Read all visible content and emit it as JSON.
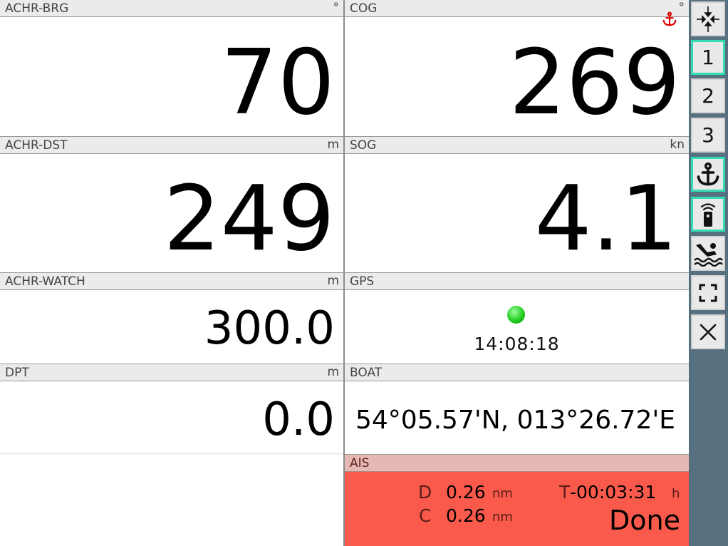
{
  "panels": {
    "achr_brg": {
      "name": "ACHR-BRG",
      "unit": "°",
      "value": "70"
    },
    "cog": {
      "name": "COG",
      "unit": "°",
      "value": "269"
    },
    "achr_dst": {
      "name": "ACHR-DST",
      "unit": "m",
      "value": "249"
    },
    "sog": {
      "name": "SOG",
      "unit": "kn",
      "value": "4.1"
    },
    "achr_watch": {
      "name": "ACHR-WATCH",
      "unit": "m",
      "value": "300.0"
    },
    "gps": {
      "name": "GPS",
      "time": "14:08:18",
      "status_color": "#22cc22"
    },
    "dpt": {
      "name": "DPT",
      "unit": "m",
      "value": "0.0"
    },
    "boat": {
      "name": "BOAT",
      "position": "54°05.57'N, 013°26.72'E"
    },
    "ais": {
      "name": "AIS",
      "d_label": "D",
      "d_value": "0.26",
      "d_unit": "nm",
      "c_label": "C",
      "c_value": "0.26",
      "c_unit": "nm",
      "t_label": "T",
      "t_value": "-00:03:31",
      "t_unit": "h",
      "status": "Done"
    }
  },
  "sidebar": {
    "buttons": [
      {
        "icon": "compress-arrows-icon"
      },
      {
        "label": "1",
        "active": true
      },
      {
        "label": "2"
      },
      {
        "label": "3"
      },
      {
        "icon": "anchor-icon",
        "active": true
      },
      {
        "icon": "remote-control-icon",
        "active": true
      },
      {
        "icon": "man-overboard-icon"
      },
      {
        "icon": "fullscreen-icon"
      },
      {
        "icon": "close-icon"
      }
    ]
  },
  "colors": {
    "accent": "#33ddb4",
    "sidebar": "#577080",
    "alarm": "#fa5a4c",
    "anchor": "#e00000"
  }
}
